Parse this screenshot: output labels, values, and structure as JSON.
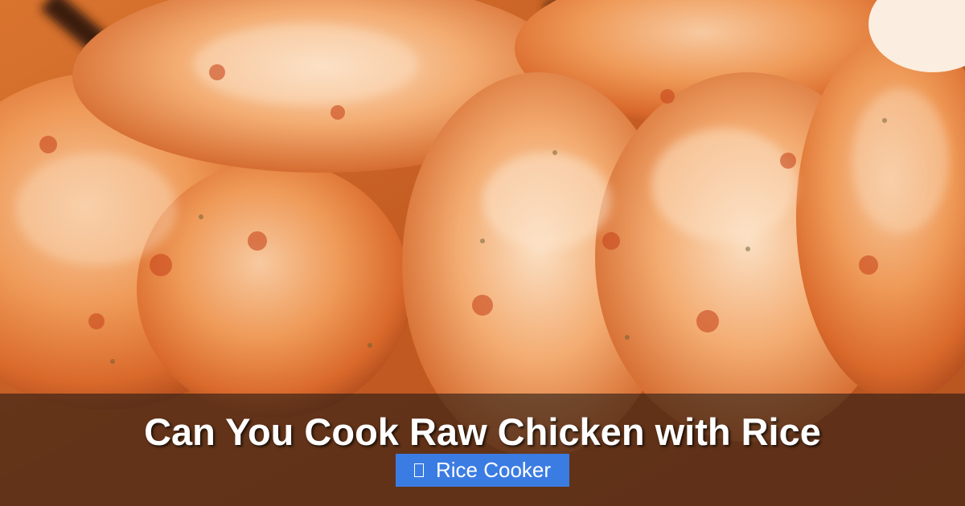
{
  "hero": {
    "title": "Can You Cook Raw Chicken with Rice",
    "category_badge": {
      "icon": "folder-icon",
      "label": "Rice Cooker",
      "color": "#3b7ce3"
    }
  },
  "colors": {
    "overlay": "#281c14",
    "title_text": "#ffffff"
  }
}
